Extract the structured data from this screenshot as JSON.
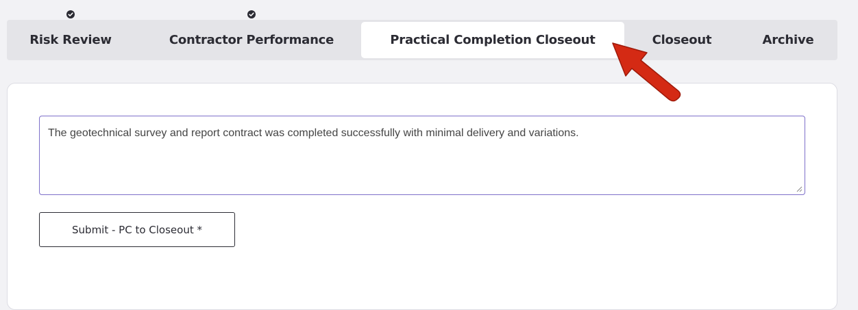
{
  "tabs": [
    {
      "label": "Risk Review",
      "completed": true,
      "active": false
    },
    {
      "label": "Contractor Performance",
      "completed": true,
      "active": false
    },
    {
      "label": "Practical Completion Closeout",
      "completed": false,
      "active": true
    },
    {
      "label": "Closeout",
      "completed": false,
      "active": false
    },
    {
      "label": "Archive",
      "completed": false,
      "active": false
    }
  ],
  "form": {
    "comment_value": "The geotechnical survey and report contract was completed successfully with minimal delivery and variations.",
    "submit_label": "Submit - PC to Closeout *"
  },
  "colors": {
    "page_bg": "#f2f2f5",
    "tabbar_bg": "#e4e4e8",
    "text_dark": "#2b2b33",
    "textarea_border": "#7d6fc9",
    "annotation_arrow": "#d42a14"
  },
  "icons": {
    "completed_tab": "check-circle-icon",
    "annotation": "red-arrow-pointer"
  }
}
